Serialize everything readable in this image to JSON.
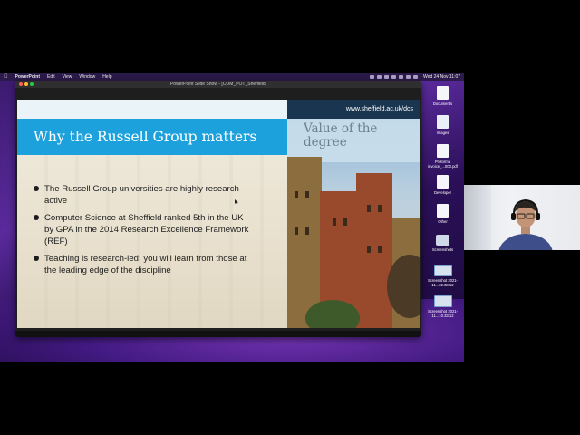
{
  "menubar": {
    "app": "PowerPoint",
    "items": [
      "Edit",
      "View",
      "Window",
      "Help"
    ],
    "clock": "Wed 24 Nov  11:07"
  },
  "window": {
    "title": "PowerPoint Slide Show - [COM_POT_Sheffield]"
  },
  "slide": {
    "url": "www.sheffield.ac.uk/dcs",
    "title": "Why the Russell Group matters",
    "side_title": "Value of the degree",
    "bullets": [
      "The Russell Group universities are highly research active",
      "Computer Science at Sheffield ranked 5th in the UK by GPA in the 2014 Research Excellence Framework (REF)",
      "Teaching is research-led: you will learn from those at the leading edge of the discipline"
    ],
    "colors": {
      "title_bar": "#1da1dc",
      "url_bar": "#1a3550"
    }
  },
  "desktop_items": [
    {
      "label": "Documents",
      "icon": "file-icon"
    },
    {
      "label": "Images",
      "icon": "image-file-icon"
    },
    {
      "label": "Proforma invoice_...000.pdf",
      "icon": "pdf-file-icon"
    },
    {
      "label": "Developer",
      "icon": "file-icon"
    },
    {
      "label": "Other",
      "icon": "file-icon"
    },
    {
      "label": "Screenshots",
      "icon": "folder-icon"
    },
    {
      "label": "Screenshot 2021-11...22.38.12",
      "icon": "screenshot-thumbnail-icon"
    },
    {
      "label": "Screenshot 2021-11...10.33.12",
      "icon": "screenshot-thumbnail-icon"
    }
  ]
}
